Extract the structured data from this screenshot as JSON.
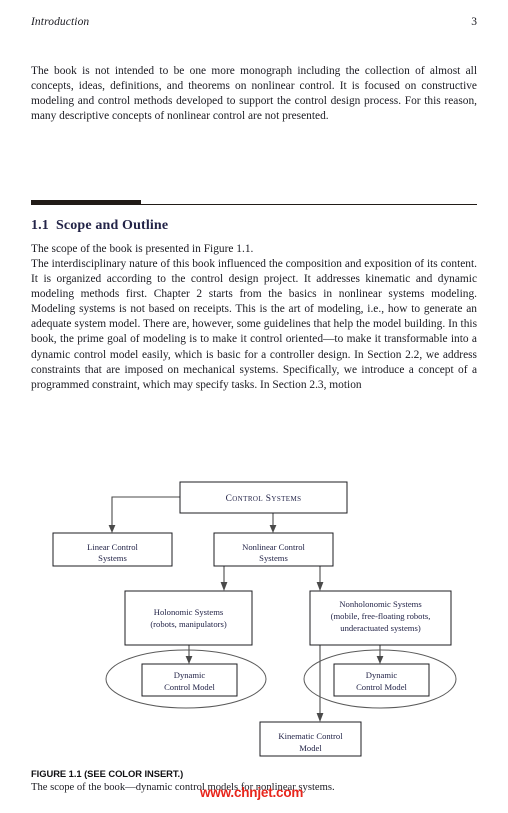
{
  "page": {
    "running_head": "Introduction",
    "folio": "3"
  },
  "paragraphs": {
    "intro": "The book is not intended to be one more monograph including the collection of almost all concepts, ideas, definitions, and theorems on nonlinear control. It is focused on constructive modeling and control methods developed to support the control design process. For this reason, many descriptive concepts of nonlinear control are not presented.",
    "scope_lead": "The scope of the book is presented in Figure 1.1.",
    "body": "The interdisciplinary nature of this book influenced the composition and exposition of its content. It is organized according to the control design project. It addresses kinematic and dynamic modeling methods first. Chapter 2 starts from the basics in nonlinear systems modeling. Modeling systems is not based on receipts. This is the art of modeling, i.e., how to generate an adequate system model. There are, however, some guidelines that help the model building. In this book, the prime goal of modeling is to make it control oriented—to make it transformable into a dynamic control model easily, which is basic for a controller design. In Section 2.2, we address constraints that are imposed on mechanical systems. Specifically, we introduce a concept of a programmed constraint, which may specify tasks. In Section 2.3, motion"
  },
  "section": {
    "number": "1.1",
    "title": "Scope and Outline",
    "heading_color": "#232448"
  },
  "figure": {
    "nodes": {
      "control_systems": "Control Systems",
      "linear_control": [
        "Linear Control",
        "Systems"
      ],
      "nonlinear_control": [
        "Nonlinear Control",
        "Systems"
      ],
      "holonomic": [
        "Holonomic Systems",
        "(robots, manipulators)"
      ],
      "nonholonomic": [
        "Nonholonomic Systems",
        "(mobile, free-floating robots,",
        "underactuated systems)"
      ],
      "dynamic_model_left": [
        "Dynamic",
        "Control Model"
      ],
      "dynamic_model_right": [
        "Dynamic",
        "Control Model"
      ],
      "kinematic_model": [
        "Kinematic Control",
        "Model"
      ]
    },
    "caption_label": "FIGURE 1.1 (SEE COLOR INSERT.)",
    "caption_body": "The scope of the book—dynamic control models for nonlinear systems.",
    "box_stroke": "#1c1c22",
    "ellipse_stroke": "#5a5a5a",
    "text_color": "#232448"
  },
  "watermark": {
    "text": "www.chnjet.com",
    "color": "#e8261c"
  }
}
